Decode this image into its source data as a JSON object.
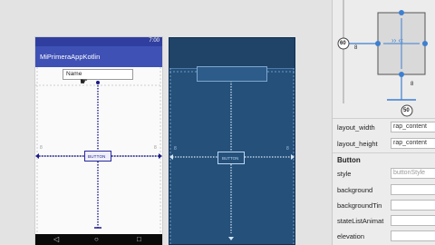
{
  "app": {
    "title": "MiPrimeraAppKotlin",
    "status_time": "7:00"
  },
  "design": {
    "name_field_text": "Name",
    "button_text": "BUTTON",
    "margin_label": "8"
  },
  "blueprint": {
    "button_text": "BUTTON",
    "margin_label": "8"
  },
  "inspector": {
    "left_margin": "60",
    "top_margin": "8",
    "bottom_margin": "8",
    "right_margin": "8",
    "bias": "50",
    "properties": [
      {
        "label": "layout_width",
        "value": "rap_content"
      },
      {
        "label": "layout_height",
        "value": "rap_content"
      }
    ],
    "section_title": "Button",
    "button_properties": [
      {
        "label": "style",
        "value": "buttonStyle"
      },
      {
        "label": "background",
        "value": ""
      },
      {
        "label": "backgroundTin",
        "value": ""
      },
      {
        "label": "stateListAnimat",
        "value": ""
      },
      {
        "label": "elevation",
        "value": ""
      }
    ]
  },
  "colors": {
    "primary": "#3f51b5",
    "primary_dark": "#303f9f",
    "blueprint": "#24507a",
    "constraint": "#1a1a8a",
    "inspector_accent": "#3d7fd0"
  }
}
